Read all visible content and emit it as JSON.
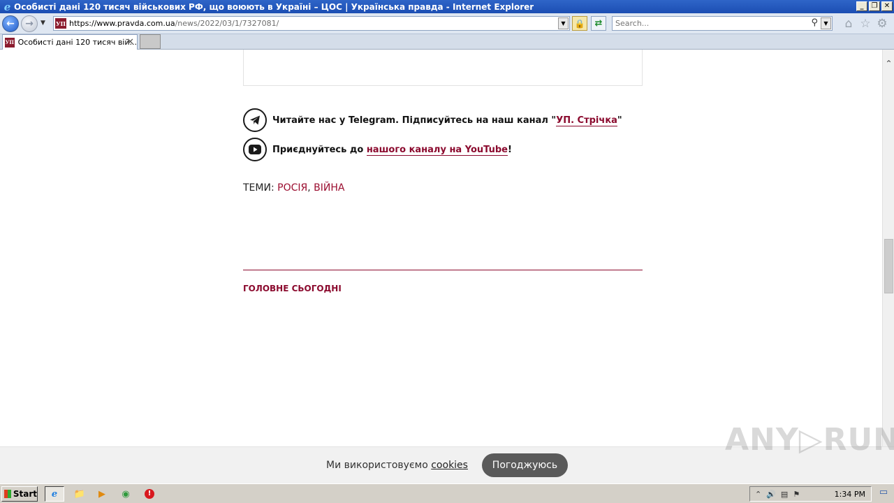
{
  "window": {
    "title": "Особисті дані 120 тисяч військових РФ, що воюють в Україні – ЦОС | Українська правда - Internet Explorer",
    "controls": [
      "_",
      "❐",
      "✕"
    ]
  },
  "toolbar": {
    "back_icon": "back-arrow-icon",
    "forward_icon": "forward-arrow-icon",
    "url_host": "https://www.pravda.com.ua",
    "url_path": "/news/2022/03/1/7327081/",
    "search_placeholder": "Search...",
    "favicon_text": "УП"
  },
  "tabs": [
    {
      "label": "Особисті дані 120 тисяч вій...",
      "close": "✕"
    }
  ],
  "article": {
    "telegram_text": "Читайте нас у Telegram. Підписуйтесь на наш канал \"",
    "telegram_link": "УП. Стрічка",
    "telegram_after": "\"",
    "youtube_text": "Приєднуйтесь до ",
    "youtube_link": "нашого каналу на YouTube",
    "youtube_after": "!",
    "topics_label": "ТЕМИ: ",
    "topics": [
      "РОСІЯ",
      "ВІЙНА"
    ],
    "topics_sep": ", ",
    "section_title": "ГОЛОВНЕ СЬОГОДНІ"
  },
  "cookie_banner": {
    "text": "Ми використовуємо ",
    "link": "cookies",
    "button": "Погоджуюсь"
  },
  "watermark": "ANY▷RUN",
  "taskbar": {
    "start_label": "Start",
    "clock": "1:34 PM"
  },
  "colors": {
    "brand": "#8b0a2e",
    "titlebar": "#1c4eb3",
    "cookie_button": "#5a5a5a"
  }
}
